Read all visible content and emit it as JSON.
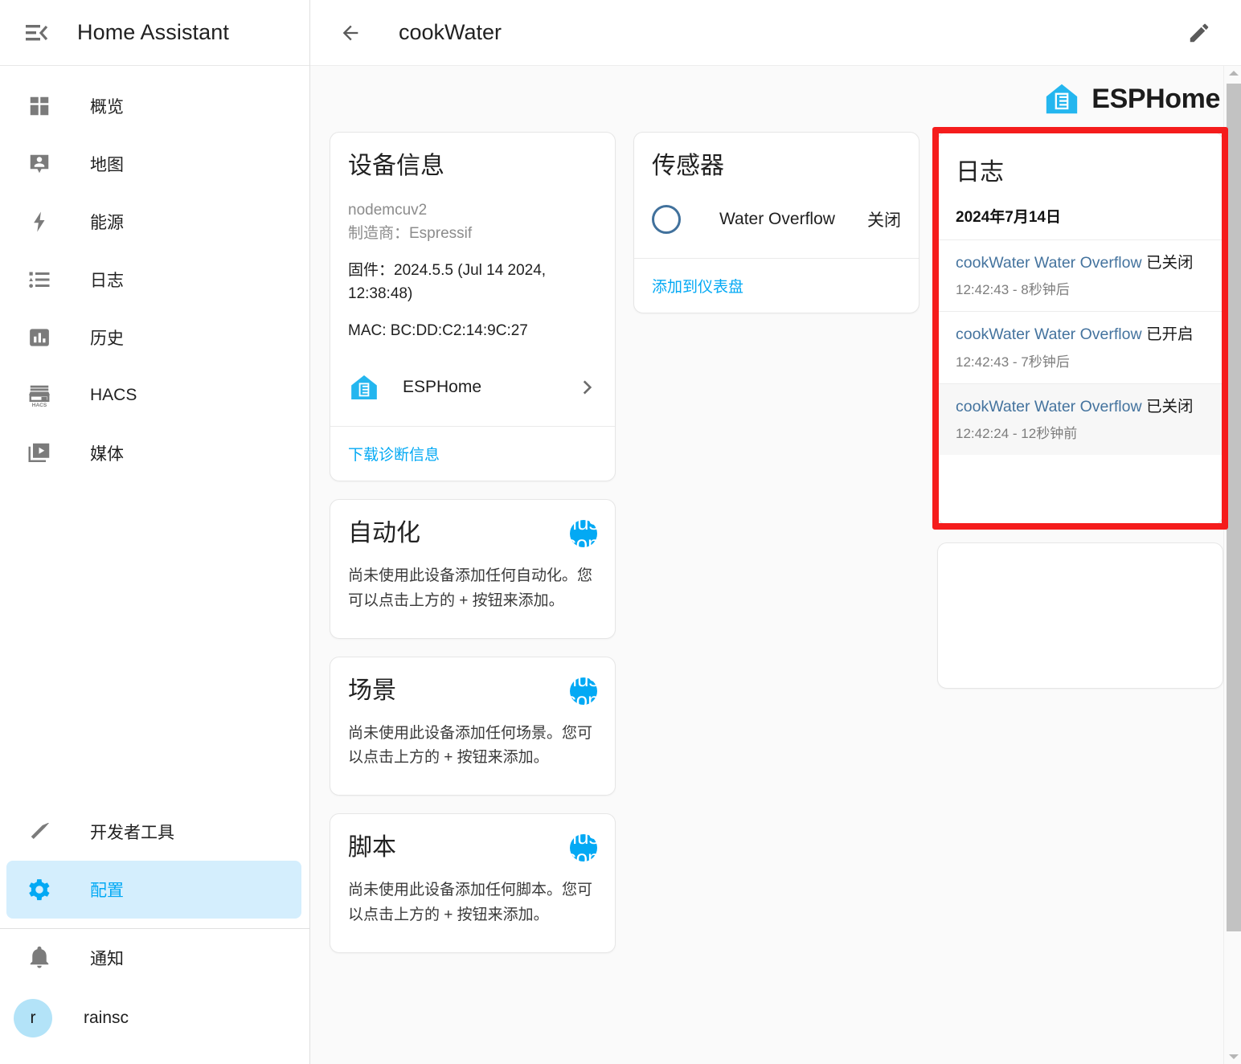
{
  "sidebar": {
    "title": "Home Assistant",
    "menu_icon": "menu-collapse-icon",
    "items": [
      {
        "label": "概览",
        "icon": "dashboard-icon"
      },
      {
        "label": "地图",
        "icon": "map-marker-account-icon"
      },
      {
        "label": "能源",
        "icon": "lightning-bolt-icon"
      },
      {
        "label": "日志",
        "icon": "logbook-list-icon"
      },
      {
        "label": "历史",
        "icon": "chart-box-icon"
      },
      {
        "label": "HACS",
        "icon": "hacs-store-icon"
      },
      {
        "label": "媒体",
        "icon": "media-play-icon"
      }
    ],
    "bottom_items": [
      {
        "label": "开发者工具",
        "icon": "hammer-icon",
        "active": false
      },
      {
        "label": "配置",
        "icon": "gear-icon",
        "active": true
      }
    ],
    "notifications": {
      "label": "通知",
      "icon": "bell-icon"
    },
    "user": {
      "label": "rainsc",
      "initial": "r"
    }
  },
  "toolbar": {
    "back_icon": "arrow-left-icon",
    "title": "cookWater",
    "edit_icon": "pencil-icon"
  },
  "brand": {
    "name": "ESPHome",
    "logo_icon": "esphome-logo-icon"
  },
  "device_info": {
    "title": "设备信息",
    "model": "nodemcuv2",
    "manufacturer": "制造商：Espressif",
    "firmware": "固件：2024.5.5 (Jul 14 2024, 12:38:48)",
    "mac": "MAC: BC:DD:C2:14:9C:27",
    "integration": "ESPHome",
    "chevron_icon": "chevron-right-icon",
    "download_diagnostics": "下载诊断信息"
  },
  "automation": {
    "title": "自动化",
    "add_icon": "plus-icon",
    "empty_text": "尚未使用此设备添加任何自动化。您可以点击上方的 + 按钮来添加。"
  },
  "scene": {
    "title": "场景",
    "add_icon": "plus-icon",
    "empty_text": "尚未使用此设备添加任何场景。您可以点击上方的 + 按钮来添加。"
  },
  "script": {
    "title": "脚本",
    "add_icon": "plus-icon",
    "empty_text": "尚未使用此设备添加任何脚本。您可以点击上方的 + 按钮来添加。"
  },
  "sensors": {
    "title": "传感器",
    "rows": [
      {
        "icon": "circle-outline-icon",
        "name": "Water Overflow",
        "state": "关闭"
      }
    ],
    "add_to_dashboard": "添加到仪表盘"
  },
  "logbook": {
    "title": "日志",
    "date": "2024年7月14日",
    "entries": [
      {
        "entity": "cookWater Water Overflow",
        "action": " 已关闭",
        "time": "12:42:43 - 8秒钟后",
        "highlight": false
      },
      {
        "entity": "cookWater Water Overflow",
        "action": " 已开启",
        "time": "12:42:43 - 7秒钟后",
        "highlight": false
      },
      {
        "entity": "cookWater Water Overflow",
        "action": " 已关闭",
        "time": "12:42:24 - 12秒钟前",
        "highlight": true
      }
    ]
  },
  "annotation": {
    "color": "#f51c1c",
    "target": "logbook-card"
  },
  "colors": {
    "accent": "#03a9f4",
    "active_bg": "#d4eefd",
    "link": "#44739e",
    "page_bg": "#fafafa",
    "annotation_red": "#f51c1c"
  }
}
